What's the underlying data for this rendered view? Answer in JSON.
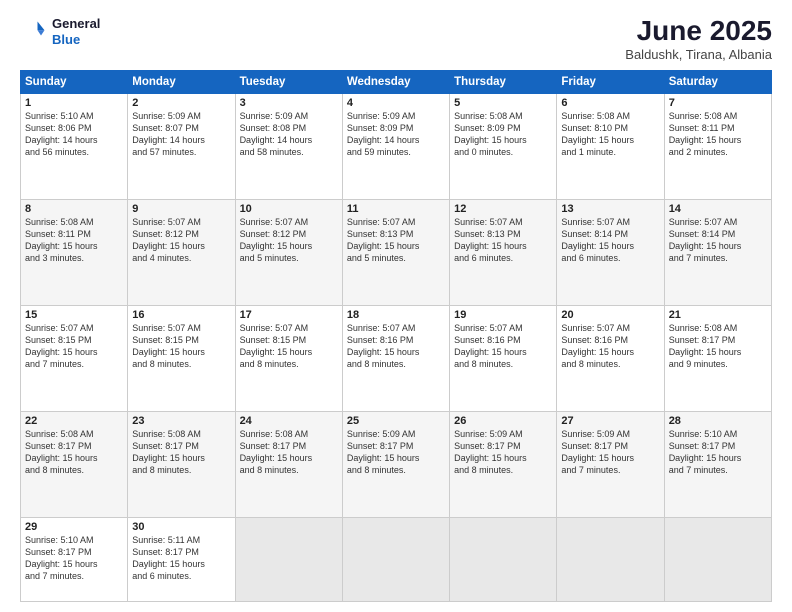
{
  "header": {
    "logo_line1": "General",
    "logo_line2": "Blue",
    "month_year": "June 2025",
    "location": "Baldushk, Tirana, Albania"
  },
  "days_of_week": [
    "Sunday",
    "Monday",
    "Tuesday",
    "Wednesday",
    "Thursday",
    "Friday",
    "Saturday"
  ],
  "weeks": [
    [
      {
        "day": "1",
        "lines": [
          "Sunrise: 5:10 AM",
          "Sunset: 8:06 PM",
          "Daylight: 14 hours",
          "and 56 minutes."
        ]
      },
      {
        "day": "2",
        "lines": [
          "Sunrise: 5:09 AM",
          "Sunset: 8:07 PM",
          "Daylight: 14 hours",
          "and 57 minutes."
        ]
      },
      {
        "day": "3",
        "lines": [
          "Sunrise: 5:09 AM",
          "Sunset: 8:08 PM",
          "Daylight: 14 hours",
          "and 58 minutes."
        ]
      },
      {
        "day": "4",
        "lines": [
          "Sunrise: 5:09 AM",
          "Sunset: 8:09 PM",
          "Daylight: 14 hours",
          "and 59 minutes."
        ]
      },
      {
        "day": "5",
        "lines": [
          "Sunrise: 5:08 AM",
          "Sunset: 8:09 PM",
          "Daylight: 15 hours",
          "and 0 minutes."
        ]
      },
      {
        "day": "6",
        "lines": [
          "Sunrise: 5:08 AM",
          "Sunset: 8:10 PM",
          "Daylight: 15 hours",
          "and 1 minute."
        ]
      },
      {
        "day": "7",
        "lines": [
          "Sunrise: 5:08 AM",
          "Sunset: 8:11 PM",
          "Daylight: 15 hours",
          "and 2 minutes."
        ]
      }
    ],
    [
      {
        "day": "8",
        "lines": [
          "Sunrise: 5:08 AM",
          "Sunset: 8:11 PM",
          "Daylight: 15 hours",
          "and 3 minutes."
        ]
      },
      {
        "day": "9",
        "lines": [
          "Sunrise: 5:07 AM",
          "Sunset: 8:12 PM",
          "Daylight: 15 hours",
          "and 4 minutes."
        ]
      },
      {
        "day": "10",
        "lines": [
          "Sunrise: 5:07 AM",
          "Sunset: 8:12 PM",
          "Daylight: 15 hours",
          "and 5 minutes."
        ]
      },
      {
        "day": "11",
        "lines": [
          "Sunrise: 5:07 AM",
          "Sunset: 8:13 PM",
          "Daylight: 15 hours",
          "and 5 minutes."
        ]
      },
      {
        "day": "12",
        "lines": [
          "Sunrise: 5:07 AM",
          "Sunset: 8:13 PM",
          "Daylight: 15 hours",
          "and 6 minutes."
        ]
      },
      {
        "day": "13",
        "lines": [
          "Sunrise: 5:07 AM",
          "Sunset: 8:14 PM",
          "Daylight: 15 hours",
          "and 6 minutes."
        ]
      },
      {
        "day": "14",
        "lines": [
          "Sunrise: 5:07 AM",
          "Sunset: 8:14 PM",
          "Daylight: 15 hours",
          "and 7 minutes."
        ]
      }
    ],
    [
      {
        "day": "15",
        "lines": [
          "Sunrise: 5:07 AM",
          "Sunset: 8:15 PM",
          "Daylight: 15 hours",
          "and 7 minutes."
        ]
      },
      {
        "day": "16",
        "lines": [
          "Sunrise: 5:07 AM",
          "Sunset: 8:15 PM",
          "Daylight: 15 hours",
          "and 8 minutes."
        ]
      },
      {
        "day": "17",
        "lines": [
          "Sunrise: 5:07 AM",
          "Sunset: 8:15 PM",
          "Daylight: 15 hours",
          "and 8 minutes."
        ]
      },
      {
        "day": "18",
        "lines": [
          "Sunrise: 5:07 AM",
          "Sunset: 8:16 PM",
          "Daylight: 15 hours",
          "and 8 minutes."
        ]
      },
      {
        "day": "19",
        "lines": [
          "Sunrise: 5:07 AM",
          "Sunset: 8:16 PM",
          "Daylight: 15 hours",
          "and 8 minutes."
        ]
      },
      {
        "day": "20",
        "lines": [
          "Sunrise: 5:07 AM",
          "Sunset: 8:16 PM",
          "Daylight: 15 hours",
          "and 8 minutes."
        ]
      },
      {
        "day": "21",
        "lines": [
          "Sunrise: 5:08 AM",
          "Sunset: 8:17 PM",
          "Daylight: 15 hours",
          "and 9 minutes."
        ]
      }
    ],
    [
      {
        "day": "22",
        "lines": [
          "Sunrise: 5:08 AM",
          "Sunset: 8:17 PM",
          "Daylight: 15 hours",
          "and 8 minutes."
        ]
      },
      {
        "day": "23",
        "lines": [
          "Sunrise: 5:08 AM",
          "Sunset: 8:17 PM",
          "Daylight: 15 hours",
          "and 8 minutes."
        ]
      },
      {
        "day": "24",
        "lines": [
          "Sunrise: 5:08 AM",
          "Sunset: 8:17 PM",
          "Daylight: 15 hours",
          "and 8 minutes."
        ]
      },
      {
        "day": "25",
        "lines": [
          "Sunrise: 5:09 AM",
          "Sunset: 8:17 PM",
          "Daylight: 15 hours",
          "and 8 minutes."
        ]
      },
      {
        "day": "26",
        "lines": [
          "Sunrise: 5:09 AM",
          "Sunset: 8:17 PM",
          "Daylight: 15 hours",
          "and 8 minutes."
        ]
      },
      {
        "day": "27",
        "lines": [
          "Sunrise: 5:09 AM",
          "Sunset: 8:17 PM",
          "Daylight: 15 hours",
          "and 7 minutes."
        ]
      },
      {
        "day": "28",
        "lines": [
          "Sunrise: 5:10 AM",
          "Sunset: 8:17 PM",
          "Daylight: 15 hours",
          "and 7 minutes."
        ]
      }
    ],
    [
      {
        "day": "29",
        "lines": [
          "Sunrise: 5:10 AM",
          "Sunset: 8:17 PM",
          "Daylight: 15 hours",
          "and 7 minutes."
        ]
      },
      {
        "day": "30",
        "lines": [
          "Sunrise: 5:11 AM",
          "Sunset: 8:17 PM",
          "Daylight: 15 hours",
          "and 6 minutes."
        ]
      },
      null,
      null,
      null,
      null,
      null
    ]
  ]
}
